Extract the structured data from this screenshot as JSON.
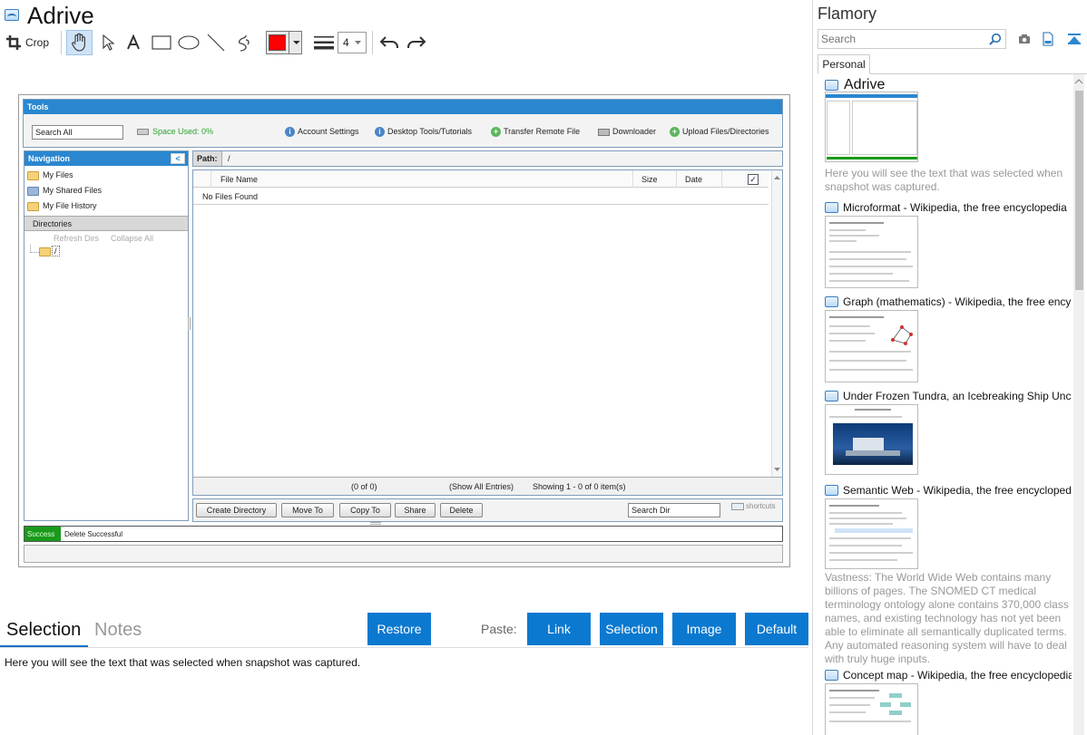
{
  "snapshot": {
    "title": "Adrive"
  },
  "toolbar": {
    "crop_label": "Crop",
    "line_width_value": "4",
    "color_hex": "#ff0000"
  },
  "adrive": {
    "tools_header": "Tools",
    "search_all": "Search All",
    "space_used": "Space Used: 0%",
    "actions": [
      "Account Settings",
      "Desktop Tools/Tutorials",
      "Transfer Remote File",
      "Downloader",
      "Upload Files/Directories"
    ],
    "nav_header": "Navigation",
    "nav_items": [
      "My Files",
      "My Shared Files",
      "My File History"
    ],
    "directories_header": "Directories",
    "refresh_dirs": "Refresh Dirs",
    "collapse_all": "Collapse All",
    "root_dir": "/",
    "path_label": "Path:",
    "path_value": "/",
    "columns": [
      "File Name",
      "Size",
      "Date"
    ],
    "empty_row": "No Files Found",
    "footer_count": "(0 of 0)",
    "footer_show_all": "(Show All Entries)",
    "footer_showing": "Showing 1 - 0 of 0 item(s)",
    "buttons": [
      "Create Directory",
      "Move To",
      "Copy To",
      "Share",
      "Delete"
    ],
    "search_dir": "Search Dir",
    "shortcuts": "shortcuts",
    "status_badge": "Success",
    "status_message": "Delete Successful"
  },
  "bottom": {
    "tab_selection": "Selection",
    "tab_notes": "Notes",
    "restore": "Restore",
    "paste_label": "Paste:",
    "paste_link": "Link",
    "paste_selection": "Selection",
    "paste_image": "Image",
    "paste_default": "Default",
    "selection_text": "Here you will see the text that was selected when snapshot was captured."
  },
  "flamory": {
    "app_name": "Flamory",
    "search_placeholder": "Search",
    "tab_personal": "Personal",
    "snapshots": [
      {
        "title": "Adrive",
        "snippet": "Here you will see the text that was selected when snapshot was captured."
      },
      {
        "title": "Microformat - Wikipedia, the free encyclopedia",
        "snippet": ""
      },
      {
        "title": "Graph (mathematics) - Wikipedia, the free ency",
        "snippet": ""
      },
      {
        "title": "Under Frozen Tundra, an Icebreaking Ship Unco",
        "snippet": ""
      },
      {
        "title": "Semantic Web - Wikipedia, the free encycloped",
        "snippet": "Vastness: The World Wide Web contains many billions of pages. The SNOMED CT medical terminology ontology alone contains 370,000 class names, and existing technology has not yet been able to eliminate all semantically duplicated terms. Any automated reasoning system will have to deal with truly huge inputs."
      },
      {
        "title": "Concept map - Wikipedia, the free encyclopedia",
        "snippet": ""
      }
    ]
  },
  "colors": {
    "accent_blue": "#0b79d0",
    "adrive_blue": "#2a87cf",
    "success_green": "#1a9a1a"
  }
}
